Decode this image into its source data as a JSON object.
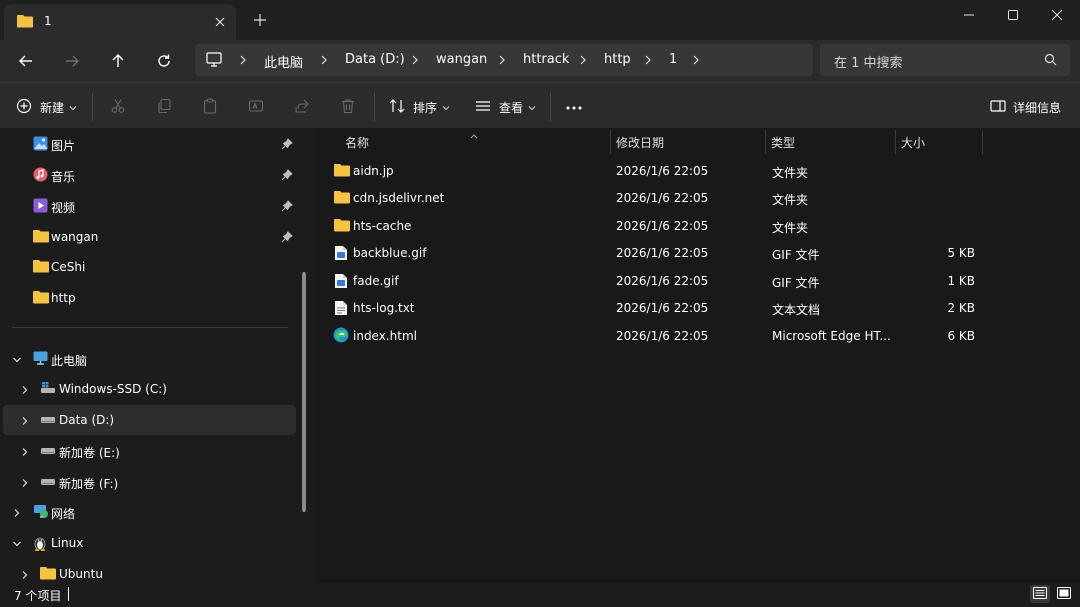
{
  "tab": {
    "title": "1"
  },
  "breadcrumb": [
    "此电脑",
    "Data (D:)",
    "wangan",
    "httrack",
    "http",
    "1"
  ],
  "search": {
    "placeholder": "在 1 中搜索"
  },
  "toolbar": {
    "new_label": "新建",
    "sort_label": "排序",
    "view_label": "查看",
    "details_label": "详细信息"
  },
  "sidebar": {
    "quick_access": [
      {
        "label": "图片",
        "icon": "pictures-icon",
        "pinned": true
      },
      {
        "label": "音乐",
        "icon": "music-icon",
        "pinned": true
      },
      {
        "label": "视频",
        "icon": "videos-icon",
        "pinned": true
      },
      {
        "label": "wangan",
        "icon": "folder-icon",
        "pinned": true
      },
      {
        "label": "CeShi",
        "icon": "folder-icon",
        "pinned": false
      },
      {
        "label": "http",
        "icon": "folder-icon",
        "pinned": false
      }
    ],
    "tree": [
      {
        "label": "此电脑",
        "icon": "pc-icon",
        "expanded": true
      },
      {
        "label": "Windows-SSD (C:)",
        "icon": "windows-drive-icon"
      },
      {
        "label": "Data (D:)",
        "icon": "drive-icon",
        "selected": true
      },
      {
        "label": "新加卷 (E:)",
        "icon": "drive-icon"
      },
      {
        "label": "新加卷 (F:)",
        "icon": "drive-icon"
      },
      {
        "label": "网络",
        "icon": "network-icon"
      },
      {
        "label": "Linux",
        "icon": "linux-icon",
        "expanded": true
      },
      {
        "label": "Ubuntu",
        "icon": "folder-icon"
      }
    ]
  },
  "columns": {
    "name": "名称",
    "date": "修改日期",
    "type": "类型",
    "size": "大小"
  },
  "files": [
    {
      "name": "aidn.jp",
      "date": "2026/1/6 22:05",
      "type": "文件夹",
      "size": "",
      "icon": "folder-icon"
    },
    {
      "name": "cdn.jsdelivr.net",
      "date": "2026/1/6 22:05",
      "type": "文件夹",
      "size": "",
      "icon": "folder-icon"
    },
    {
      "name": "hts-cache",
      "date": "2026/1/6 22:05",
      "type": "文件夹",
      "size": "",
      "icon": "folder-icon"
    },
    {
      "name": "backblue.gif",
      "date": "2026/1/6 22:05",
      "type": "GIF 文件",
      "size": "5 KB",
      "icon": "gif-file-icon"
    },
    {
      "name": "fade.gif",
      "date": "2026/1/6 22:05",
      "type": "GIF 文件",
      "size": "1 KB",
      "icon": "gif-file-icon"
    },
    {
      "name": "hts-log.txt",
      "date": "2026/1/6 22:05",
      "type": "文本文档",
      "size": "2 KB",
      "icon": "text-file-icon"
    },
    {
      "name": "index.html",
      "date": "2026/1/6 22:05",
      "type": "Microsoft Edge HT...",
      "size": "6 KB",
      "icon": "edge-icon"
    }
  ],
  "status": {
    "item_count": "7 个项目"
  },
  "colors": {
    "folder": "#f4c342",
    "accent": "#4cc2ff",
    "background": "#1c1c1c"
  }
}
